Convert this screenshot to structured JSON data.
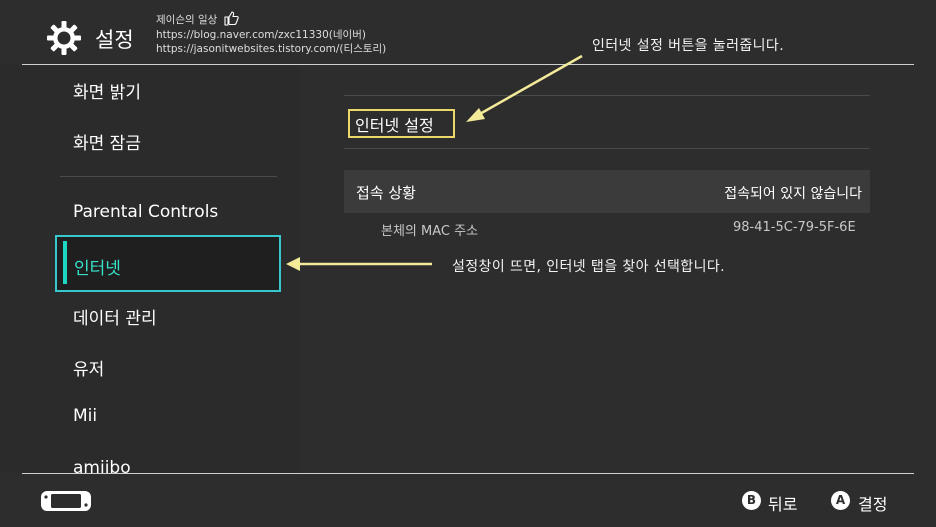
{
  "header": {
    "title": "설정",
    "blog_name": "제이슨의 일상",
    "blog_url_1": "https://blog.naver.com/zxc11330(네이버)",
    "blog_url_2": "https://jasonitwebsites.tistory.com/(티스토리)",
    "icons": {
      "settings": "gear-icon",
      "blog": "thumbs-up-icon"
    }
  },
  "sidebar": {
    "items": [
      {
        "label": "화면 밝기"
      },
      {
        "label": "화면 잠금"
      },
      {
        "label": "Parental Controls"
      },
      {
        "label": "인터넷",
        "selected": true
      },
      {
        "label": "데이터 관리"
      },
      {
        "label": "유저"
      },
      {
        "label": "Mii"
      },
      {
        "label": "amiibo"
      }
    ]
  },
  "main": {
    "internet_settings_label": "인터넷 설정",
    "status_label": "접속 상황",
    "status_value": "접속되어 있지 않습니다",
    "mac_label": "본체의 MAC 주소",
    "mac_value": "98-41-5C-79-5F-6E"
  },
  "annotations": {
    "top": "인터넷 설정 버튼을 눌러줍니다.",
    "middle": "설정창이 뜨면, 인터넷 탭을 찾아 선택합니다."
  },
  "footer": {
    "back_key": "B",
    "back_label": "뒤로",
    "ok_key": "A",
    "ok_label": "결정",
    "icons": {
      "console": "switch-console-icon"
    }
  },
  "colors": {
    "background": "#2d2d2d",
    "selection_border": "#36c7cf",
    "selection_text": "#37e2c8",
    "highlight_box": "#ecd86a",
    "arrow": "#f3ea9a"
  }
}
